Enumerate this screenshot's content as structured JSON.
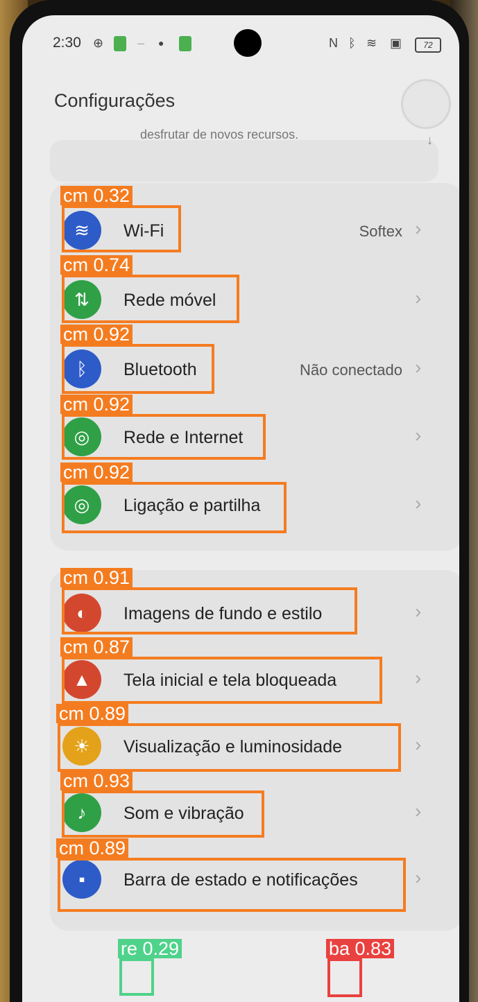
{
  "status_bar": {
    "time": "2:30",
    "battery": "72"
  },
  "header": {
    "title": "Configurações"
  },
  "partial_text": "desfrutar de novos recursos.",
  "connectivity": [
    {
      "label": "Wi-Fi",
      "value": "Softex",
      "icon": "wifi-icon",
      "color": "#2d5bc8"
    },
    {
      "label": "Rede móvel",
      "value": "",
      "icon": "mobile-data-icon",
      "color": "#2fa046"
    },
    {
      "label": "Bluetooth",
      "value": "Não conectado",
      "icon": "bluetooth-icon",
      "color": "#2d5bc8"
    },
    {
      "label": "Rede e Internet",
      "value": "",
      "icon": "network-icon",
      "color": "#2fa046"
    },
    {
      "label": "Ligação e partilha",
      "value": "",
      "icon": "share-icon",
      "color": "#2fa046"
    }
  ],
  "personalization": [
    {
      "label": "Imagens de fundo e estilo",
      "icon": "palette-icon",
      "color": "#d4472f"
    },
    {
      "label": "Tela inicial e tela bloqueada",
      "icon": "image-icon",
      "color": "#d4472f"
    },
    {
      "label": "Visualização e luminosidade",
      "icon": "sun-icon",
      "color": "#e4a21a"
    },
    {
      "label": "Som e vibração",
      "icon": "bell-icon",
      "color": "#2fa046"
    },
    {
      "label": "Barra de estado e notificações",
      "icon": "notification-icon",
      "color": "#2d5bc8"
    }
  ],
  "detections": [
    {
      "tag": "cm 0.32"
    },
    {
      "tag": "cm 0.74"
    },
    {
      "tag": "cm 0.92"
    },
    {
      "tag": "cm 0.92"
    },
    {
      "tag": "cm 0.92"
    },
    {
      "tag": "cm 0.91"
    },
    {
      "tag": "cm 0.87"
    },
    {
      "tag": "cm 0.89"
    },
    {
      "tag": "cm 0.93"
    },
    {
      "tag": "cm 0.89"
    },
    {
      "tag": "re 0.29",
      "color": "#4fd28a"
    },
    {
      "tag": "ba 0.83",
      "color": "#e9413f"
    }
  ]
}
